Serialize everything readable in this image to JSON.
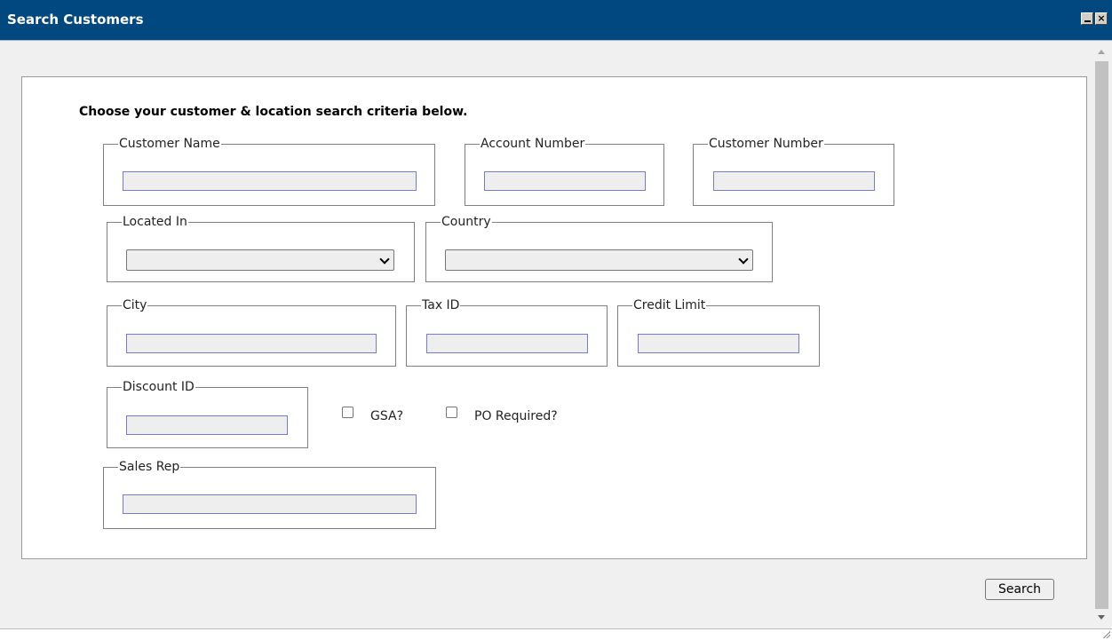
{
  "window": {
    "title": "Search Customers"
  },
  "form": {
    "instructions": "Choose your customer & location search criteria below.",
    "groups": {
      "customer_name": {
        "label": "Customer Name",
        "value": ""
      },
      "account_number": {
        "label": "Account Number",
        "value": ""
      },
      "customer_number": {
        "label": "Customer Number",
        "value": ""
      },
      "located_in": {
        "label": "Located In",
        "value": ""
      },
      "country": {
        "label": "Country",
        "value": ""
      },
      "city": {
        "label": "City",
        "value": ""
      },
      "tax_id": {
        "label": "Tax ID",
        "value": ""
      },
      "credit_limit": {
        "label": "Credit Limit",
        "value": ""
      },
      "discount_id": {
        "label": "Discount ID",
        "value": ""
      },
      "sales_rep": {
        "label": "Sales Rep",
        "value": ""
      }
    },
    "checkboxes": {
      "gsa": {
        "label": "GSA?",
        "checked": false
      },
      "po_required": {
        "label": "PO Required?",
        "checked": false
      }
    },
    "search_label": "Search"
  },
  "icons": {
    "minimize": "minimize-icon",
    "close": "close-icon",
    "scroll_up": "scroll-up-icon",
    "scroll_down": "scroll-down-icon",
    "dropdown": "chevron-down-icon",
    "resize": "resize-grip-icon"
  },
  "colors": {
    "titlebar": "#00487f",
    "background": "#f0f0f0",
    "panel": "#ffffff",
    "input_border": "#7a7acb",
    "input_bg": "#eeeeee"
  }
}
